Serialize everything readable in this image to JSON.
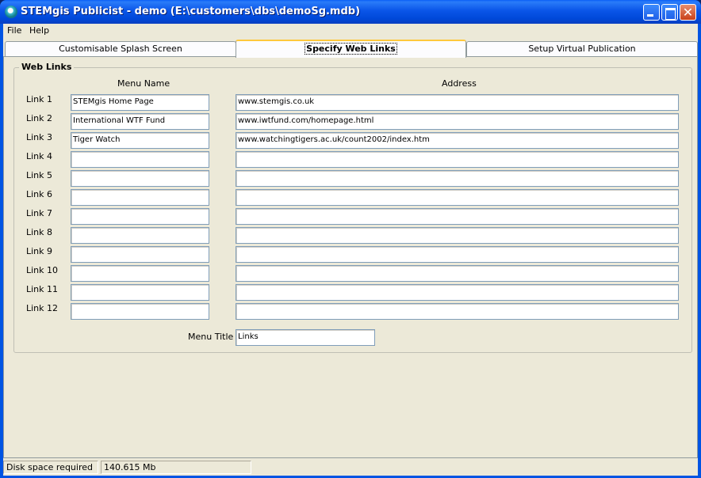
{
  "window": {
    "title": "STEMgis Publicist - demo (E:\\customers\\dbs\\demoSg.mdb)",
    "close_glyph": "✕"
  },
  "menubar": {
    "items": [
      "File",
      "Help"
    ]
  },
  "tabs": [
    {
      "label": "Customisable Splash Screen",
      "active": false
    },
    {
      "label": "Specify Web Links",
      "active": true
    },
    {
      "label": "Setup Virtual Publication",
      "active": false
    }
  ],
  "group": {
    "title": "Web Links",
    "col_menu_name": "Menu Name",
    "col_address": "Address"
  },
  "links": [
    {
      "label": "Link 1",
      "name": "STEMgis Home Page",
      "address": "www.stemgis.co.uk"
    },
    {
      "label": "Link 2",
      "name": "International WTF Fund",
      "address": "www.iwtfund.com/homepage.html"
    },
    {
      "label": "Link 3",
      "name": "Tiger Watch",
      "address": "www.watchingtigers.ac.uk/count2002/index.htm"
    },
    {
      "label": "Link 4",
      "name": "",
      "address": ""
    },
    {
      "label": "Link 5",
      "name": "",
      "address": ""
    },
    {
      "label": "Link 6",
      "name": "",
      "address": ""
    },
    {
      "label": "Link 7",
      "name": "",
      "address": ""
    },
    {
      "label": "Link 8",
      "name": "",
      "address": ""
    },
    {
      "label": "Link 9",
      "name": "",
      "address": ""
    },
    {
      "label": "Link 10",
      "name": "",
      "address": ""
    },
    {
      "label": "Link 11",
      "name": "",
      "address": ""
    },
    {
      "label": "Link 12",
      "name": "",
      "address": ""
    }
  ],
  "menu_title": {
    "label": "Menu Title",
    "value": "Links"
  },
  "status": {
    "label": "Disk space required",
    "value": "140.615 Mb"
  },
  "colors": {
    "title_blue": "#0054e3",
    "face": "#ece9d8",
    "tab_accent": "#ffc83c",
    "field_border": "#7f9db9"
  }
}
